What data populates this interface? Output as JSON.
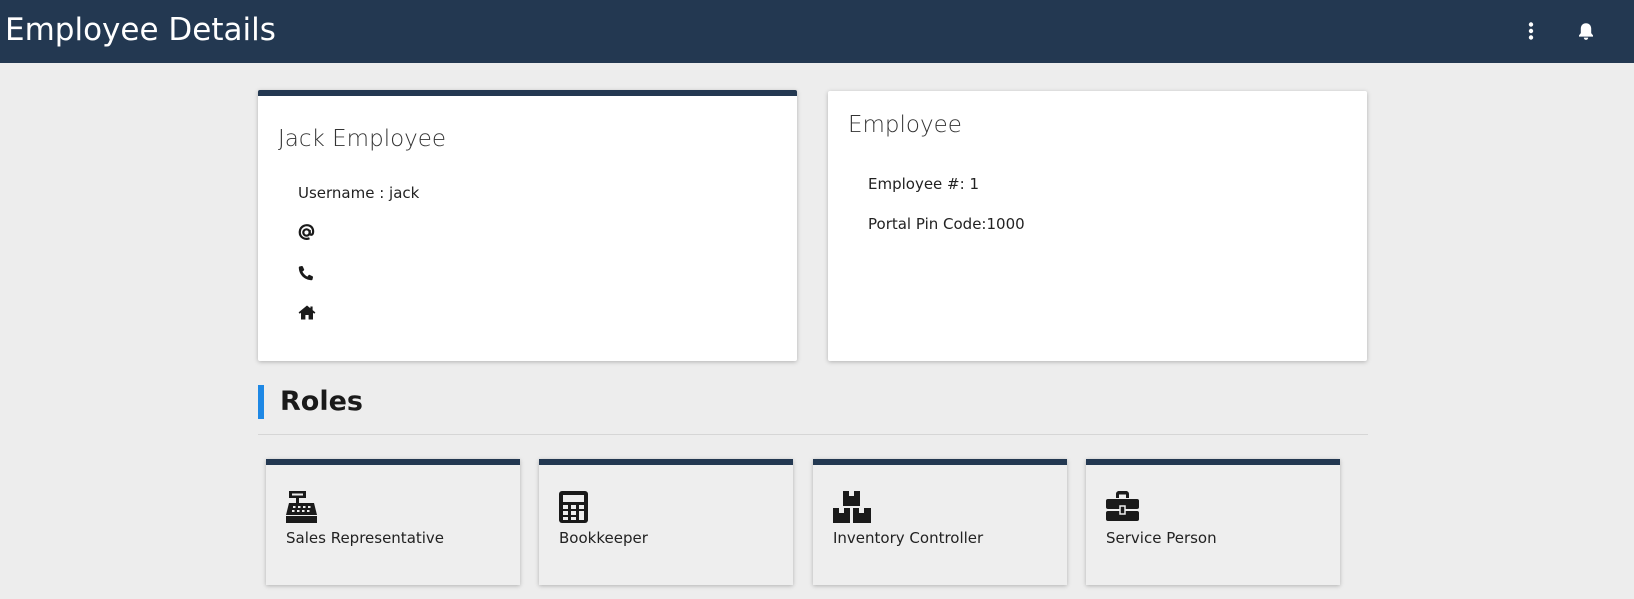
{
  "header": {
    "title": "Employee Details",
    "more_icon": "vertical-dots-icon",
    "bell_icon": "bell-icon",
    "background": "#233851"
  },
  "profile_card": {
    "name": "Jack Employee",
    "username_label": "Username : jack",
    "email_icon": "at-icon",
    "phone_icon": "phone-icon",
    "address_icon": "home-icon"
  },
  "employee_card": {
    "title": "Employee",
    "employee_number": "Employee #: 1",
    "portal_pin": "Portal Pin Code:1000"
  },
  "roles": {
    "heading": "Roles",
    "accent": "#1e88e5",
    "items": [
      {
        "label": "Sales Representative",
        "icon": "cash-register-icon"
      },
      {
        "label": "Bookkeeper",
        "icon": "calculator-icon"
      },
      {
        "label": "Inventory Controller",
        "icon": "boxes-icon"
      },
      {
        "label": "Service Person",
        "icon": "toolbox-icon"
      }
    ]
  }
}
